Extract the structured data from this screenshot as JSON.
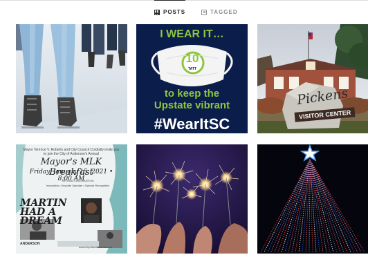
{
  "tabs": [
    {
      "label": "POSTS",
      "icon": "grid-icon",
      "active": true
    },
    {
      "label": "TAGGED",
      "icon": "tag-icon",
      "active": false
    }
  ],
  "posts": [
    {
      "id": "post-ice-skating",
      "alt_kind": "photo"
    },
    {
      "id": "post-wear-it",
      "headline": "I WEAR IT…",
      "mask_text": "10",
      "mask_badge": "TATT",
      "line1": "to keep the",
      "line2": "Upstate vibrant",
      "hashtag": "#WearItSC",
      "colors": {
        "background": "#0b1d4a",
        "accent": "#8dc63f"
      }
    },
    {
      "id": "post-pickens-visitor-center",
      "sign_name": "Pickens",
      "sign_sub": "VISITOR CENTER"
    },
    {
      "id": "post-mlk-breakfast",
      "header": "Mayor Terence V. Roberts and City Council Cordially invite you to join the City of Anderson's Annual",
      "title": "Mayor's MLK Breakfast",
      "date": "Friday, January 15, 2021 • 8:00 AM",
      "virtual": "VIRTUAL CELEBRATION",
      "details": "Invocation • Keynote Speaker • Special Recognition",
      "quote": "MARTIN HAD A DREAM",
      "logo": "ANDERSON",
      "footer": "www.cityofandersonsc.com"
    },
    {
      "id": "post-sparklers",
      "alt_kind": "photo"
    },
    {
      "id": "post-christmas-tree",
      "alt_kind": "photo"
    }
  ]
}
